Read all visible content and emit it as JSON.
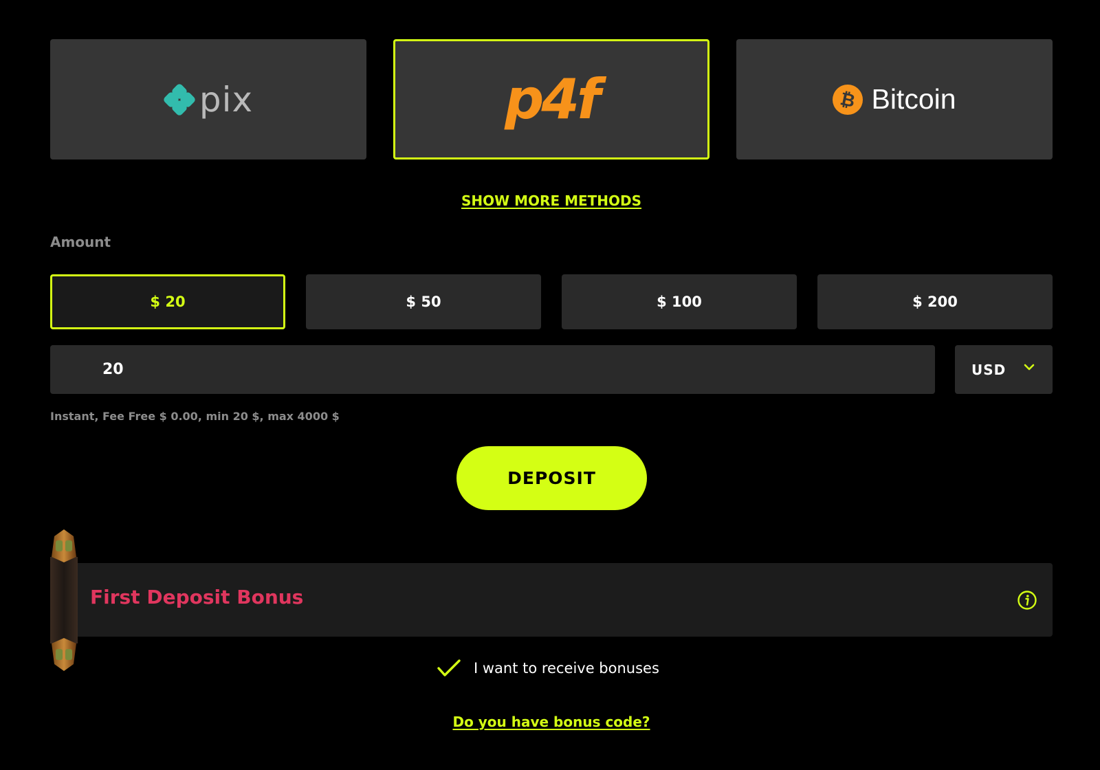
{
  "colors": {
    "accent": "#d4ff14",
    "bonus_title": "#e0365e",
    "bitcoin": "#f7931a",
    "pix_teal": "#32bcad"
  },
  "payment_methods": [
    {
      "name": "pix",
      "label": "pix",
      "icon": "pix-diamond-icon",
      "selected": false
    },
    {
      "name": "p4f",
      "label": "p4f",
      "icon": "p4f-logo",
      "selected": true
    },
    {
      "name": "bitcoin",
      "label": "Bitcoin",
      "icon": "bitcoin-icon",
      "selected": false
    }
  ],
  "show_more_label": "SHOW MORE METHODS",
  "amount": {
    "label": "Amount",
    "presets": [
      "$ 20",
      "$ 50",
      "$ 100",
      "$ 200"
    ],
    "selected_preset": "$ 20",
    "input_value": "20",
    "currency": "USD",
    "info": "Instant, Fee Free $ 0.00, min 20 $, max 4000 $"
  },
  "deposit_label": "DEPOSIT",
  "bonus": {
    "title": "First Deposit Bonus",
    "receive_label": "I want to receive bonuses",
    "receive_checked": true,
    "code_link": "Do you have bonus code?"
  }
}
